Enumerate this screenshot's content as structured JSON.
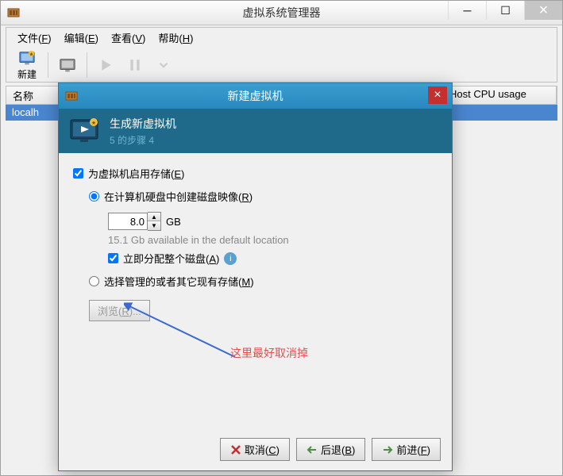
{
  "main_window": {
    "title": "虚拟系统管理器",
    "menu": {
      "file": "文件(F)",
      "edit": "编辑(E)",
      "view": "查看(V)",
      "help": "帮助(H)"
    },
    "toolbar": {
      "new": "新建"
    },
    "table": {
      "col_name": "名称",
      "col_cpu": "Host CPU usage",
      "row0": "localhost"
    }
  },
  "dialog": {
    "title": "新建虚拟机",
    "header_title": "生成新虚拟机",
    "header_step": "5 的步骤 4",
    "enable_storage": "为虚拟机启用存储(E)",
    "create_image": "在计算机硬盘中创建磁盘映像(R)",
    "size_value": "8.0",
    "gb": "GB",
    "available": "15.1 Gb available in the default location",
    "allocate_now": "立即分配整个磁盘(A)",
    "managed_storage": "选择管理的或者其它现有存储(M)",
    "browse": "浏览(R)...",
    "cancel": "取消(C)",
    "back": "后退(B)",
    "forward": "前进(F)"
  },
  "annotation": "这里最好取消掉"
}
